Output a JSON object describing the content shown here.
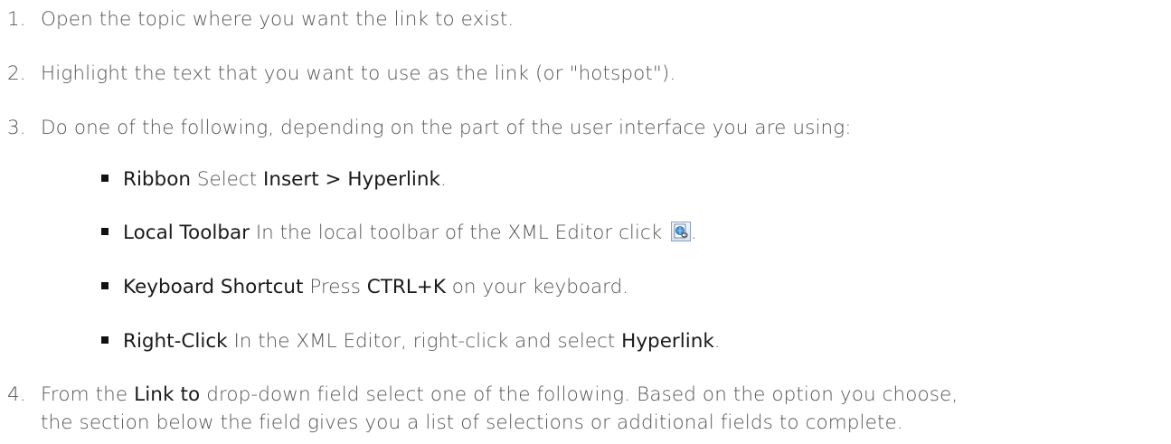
{
  "steps": [
    {
      "num": "1.",
      "text": "Open the  topic where you want the link to exist."
    },
    {
      "num": "2.",
      "text": "Highlight the text that you want to use as the link (or \"hotspot\")."
    },
    {
      "num": "3.",
      "text": "Do one of the following, depending on the part of the user interface you are using:"
    },
    {
      "num": "4.",
      "pre": "From the ",
      "bold": "Link to",
      "post_line1": " drop-down field select one of the following. Based on the option you choose,",
      "line2": "the section below the field gives you a list of selections or additional fields to complete."
    }
  ],
  "options": [
    {
      "label": "Ribbon",
      "text_pre": " Select ",
      "bold": "Insert > Hyperlink",
      "text_post": "."
    },
    {
      "label": "Local Toolbar",
      "text_pre": " In the local toolbar of the XML Editor click ",
      "icon": "insert-hyperlink-icon",
      "text_post": "."
    },
    {
      "label": "Keyboard Shortcut",
      "text_pre": " Press ",
      "bold": "CTRL+K",
      "text_post": " on your keyboard."
    },
    {
      "label": "Right-Click",
      "text_pre": " In the XML Editor, right-click and select ",
      "bold": "Hyperlink",
      "text_post": "."
    }
  ]
}
